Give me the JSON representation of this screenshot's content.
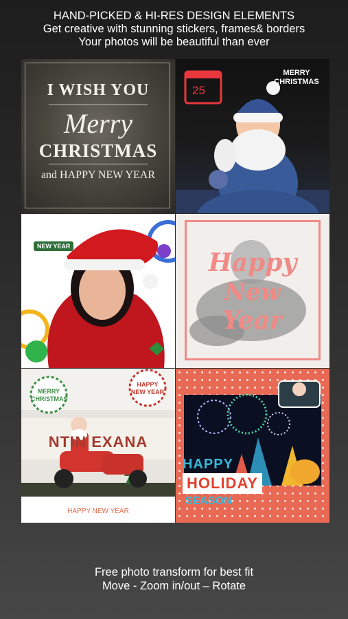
{
  "header": {
    "line1": "HAND-PICKED & HI-RES DESIGN ELEMENTS",
    "line2": "Get creative with stunning stickers, frames& borders",
    "line3": "Your photos will be beautiful than ever"
  },
  "tiles": {
    "t1": {
      "l1": "I WISH YOU",
      "l2": "Merry",
      "l3": "CHRISTMAS",
      "l4": "and HAPPY NEW YEAR"
    },
    "t2": {
      "calendar": "25",
      "l1": "MERRY",
      "l2": "CHRISTMAS"
    },
    "t3": {
      "badge": "NEW YEAR"
    },
    "t4": {
      "l1": "Happy",
      "l2": "New",
      "l3": "Year"
    },
    "t5": {
      "badge1a": "MERRY",
      "badge1b": "CHRISTMAS",
      "badge2a": "HAPPY",
      "badge2b": "NEW YEAR",
      "sign": "NTIN  EXANA",
      "bottom": "HAPPY NEW YEAR"
    },
    "t6": {
      "top": "HAPPY",
      "mid": "HOLIDAY",
      "bot": "SEASON"
    }
  },
  "footer": {
    "line1": "Free photo transform for best fit",
    "line2": "Move - Zoom in/out – Rotate"
  }
}
